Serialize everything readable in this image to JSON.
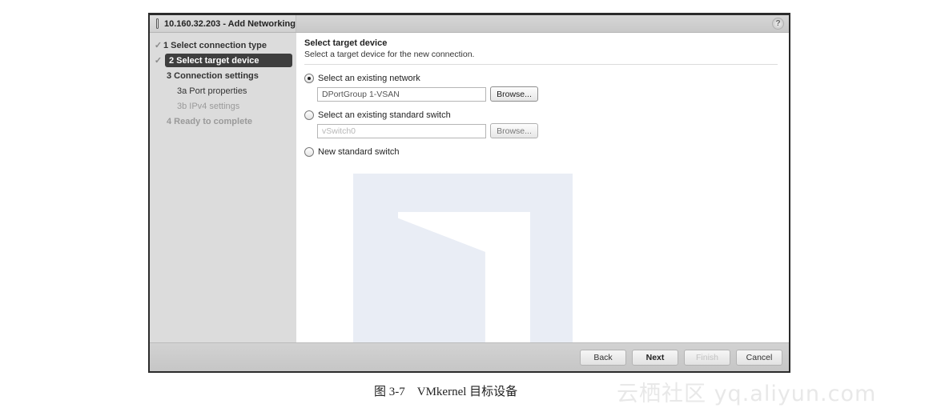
{
  "window": {
    "title": "10.160.32.203 - Add Networking",
    "help_label": "?"
  },
  "sidebar": {
    "steps": [
      {
        "label": "1 Select connection type",
        "state": "completed"
      },
      {
        "label": "2 Select target device",
        "state": "active"
      },
      {
        "label": "3 Connection settings",
        "state": "pending"
      },
      {
        "label": "3a Port properties",
        "state": "pending"
      },
      {
        "label": "3b IPv4 settings",
        "state": "disabled"
      },
      {
        "label": "4 Ready to complete",
        "state": "disabled"
      }
    ],
    "check_glyph": "✓"
  },
  "main": {
    "title": "Select target device",
    "subtitle": "Select a target device for the new connection.",
    "options": [
      {
        "label": "Select an existing network",
        "selected": true,
        "field_value": "DPortGroup 1-VSAN",
        "browse_label": "Browse...",
        "enabled": true
      },
      {
        "label": "Select an existing standard switch",
        "selected": false,
        "field_value": "vSwitch0",
        "browse_label": "Browse...",
        "enabled": false
      },
      {
        "label": "New standard switch",
        "selected": false
      }
    ]
  },
  "footer": {
    "back": "Back",
    "next": "Next",
    "finish": "Finish",
    "cancel": "Cancel"
  },
  "caption": "图 3-7　VMkernel 目标设备",
  "watermark": "云栖社区 yq.aliyun.com"
}
